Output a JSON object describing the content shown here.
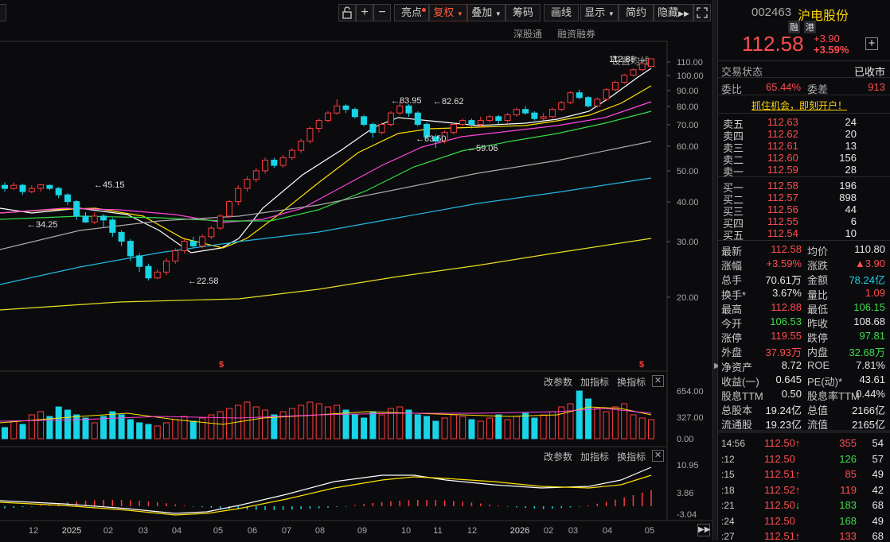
{
  "toolbar": {
    "buttons": [
      "亮点",
      "复权",
      "叠加",
      "筹码",
      "画线",
      "显示",
      "简约",
      "隐藏"
    ],
    "icons": [
      "unlock-icon",
      "zoom-in-icon",
      "zoom-out-icon",
      "expand-icon"
    ]
  },
  "sublinks": [
    "深股通",
    "融资融券",
    "设置均线"
  ],
  "main_chart": {
    "price_axis": [
      "110.00",
      "100.00",
      "90.00",
      "80.00",
      "70.00",
      "60.00",
      "50.00",
      "40.00",
      "30.00",
      "20.00"
    ],
    "annotations": [
      "112.88",
      "83.95",
      "82.62",
      "63.50",
      "59.06",
      "45.15",
      "34.25",
      "22.58"
    ]
  },
  "volume_panel": {
    "buttons": [
      "改参数",
      "加指标",
      "换指标"
    ],
    "axis": [
      "654.00",
      "327.00",
      "0.00"
    ]
  },
  "macd_panel": {
    "buttons": [
      "改参数",
      "加指标",
      "换指标"
    ],
    "axis": [
      "10.95",
      "3.86",
      "-3.04"
    ]
  },
  "time_axis": [
    "12",
    "2025",
    "02",
    "03",
    "04",
    "05",
    "06",
    "07",
    "08",
    "09",
    "10",
    "11",
    "12",
    "2026",
    "02",
    "03",
    "04",
    "05"
  ],
  "stock": {
    "code": "002463",
    "name": "沪电股份",
    "tags": [
      "融",
      "港"
    ],
    "price": "112.58",
    "change": "+3.90",
    "change_pct": "+3.59%"
  },
  "status": {
    "label": "交易状态",
    "value": "已收市"
  },
  "webi": {
    "label1": "委比",
    "value1": "65.44%",
    "label2": "委差",
    "value2": "913"
  },
  "promo": "抓住机会，即刻开户！",
  "sell_orders": [
    {
      "label": "卖五",
      "price": "112.63",
      "vol": "24"
    },
    {
      "label": "卖四",
      "price": "112.62",
      "vol": "20"
    },
    {
      "label": "卖三",
      "price": "112.61",
      "vol": "13"
    },
    {
      "label": "卖二",
      "price": "112.60",
      "vol": "156"
    },
    {
      "label": "卖一",
      "price": "112.59",
      "vol": "28"
    }
  ],
  "buy_orders": [
    {
      "label": "买一",
      "price": "112.58",
      "vol": "196"
    },
    {
      "label": "买二",
      "price": "112.57",
      "vol": "898"
    },
    {
      "label": "买三",
      "price": "112.56",
      "vol": "44"
    },
    {
      "label": "买四",
      "price": "112.55",
      "vol": "6"
    },
    {
      "label": "买五",
      "price": "112.54",
      "vol": "10"
    }
  ],
  "quote": [
    {
      "l1": "最新",
      "v1": "112.58",
      "c1": "r",
      "l2": "均价",
      "v2": "110.80",
      "c2": "w"
    },
    {
      "l1": "涨幅",
      "v1": "+3.59%",
      "c1": "r",
      "l2": "涨跌",
      "v2": "▲3.90",
      "c2": "r"
    },
    {
      "l1": "总手",
      "v1": "70.61万",
      "c1": "w",
      "l2": "金额",
      "v2": "78.24亿",
      "c2": "c"
    },
    {
      "l1": "换手*",
      "v1": "3.67%",
      "c1": "w",
      "l2": "量比",
      "v2": "1.09",
      "c2": "r"
    },
    {
      "l1": "最高",
      "v1": "112.88",
      "c1": "r",
      "l2": "最低",
      "v2": "106.15",
      "c2": "g"
    },
    {
      "l1": "今开",
      "v1": "106.53",
      "c1": "g",
      "l2": "昨收",
      "v2": "108.68",
      "c2": "w"
    },
    {
      "l1": "涨停",
      "v1": "119.55",
      "c1": "r",
      "l2": "跌停",
      "v2": "97.81",
      "c2": "g"
    },
    {
      "l1": "外盘",
      "v1": "37.93万",
      "c1": "r",
      "l2": "内盘",
      "v2": "32.68万",
      "c2": "g"
    },
    {
      "l1": "净资产",
      "v1": "8.72",
      "c1": "w",
      "l2": "ROE",
      "v2": "7.81%",
      "c2": "w"
    },
    {
      "l1": "收益(一)",
      "v1": "0.645",
      "c1": "w",
      "l2": "PE(动)*",
      "v2": "43.61",
      "c2": "w"
    },
    {
      "l1": "股息TTM",
      "v1": "0.50",
      "c1": "w",
      "l2": "股息率TTM",
      "v2": "0.44%",
      "c2": "w"
    },
    {
      "l1": "总股本",
      "v1": "19.24亿",
      "c1": "w",
      "l2": "总值",
      "v2": "2166亿",
      "c2": "w"
    },
    {
      "l1": "流通股",
      "v1": "19.23亿",
      "c1": "w",
      "l2": "流值",
      "v2": "2165亿",
      "c2": "w"
    }
  ],
  "ticks": [
    {
      "time": "14:56",
      "price": "112.50",
      "arrow": "↑",
      "vol": "355",
      "n": "54",
      "vc": "r"
    },
    {
      "time": ":12",
      "price": "112.50",
      "arrow": "",
      "vol": "126",
      "n": "57",
      "vc": "g"
    },
    {
      "time": ":15",
      "price": "112.51",
      "arrow": "↑",
      "vol": "85",
      "n": "49",
      "vc": "r"
    },
    {
      "time": ":18",
      "price": "112.52",
      "arrow": "↑",
      "vol": "119",
      "n": "42",
      "vc": "r"
    },
    {
      "time": ":21",
      "price": "112.50",
      "arrow": "↓",
      "vol": "183",
      "n": "68",
      "vc": "g"
    },
    {
      "time": ":24",
      "price": "112.50",
      "arrow": "",
      "vol": "168",
      "n": "49",
      "vc": "g"
    },
    {
      "time": ":27",
      "price": "112.51",
      "arrow": "↑",
      "vol": "133",
      "n": "68",
      "vc": "r"
    }
  ]
}
